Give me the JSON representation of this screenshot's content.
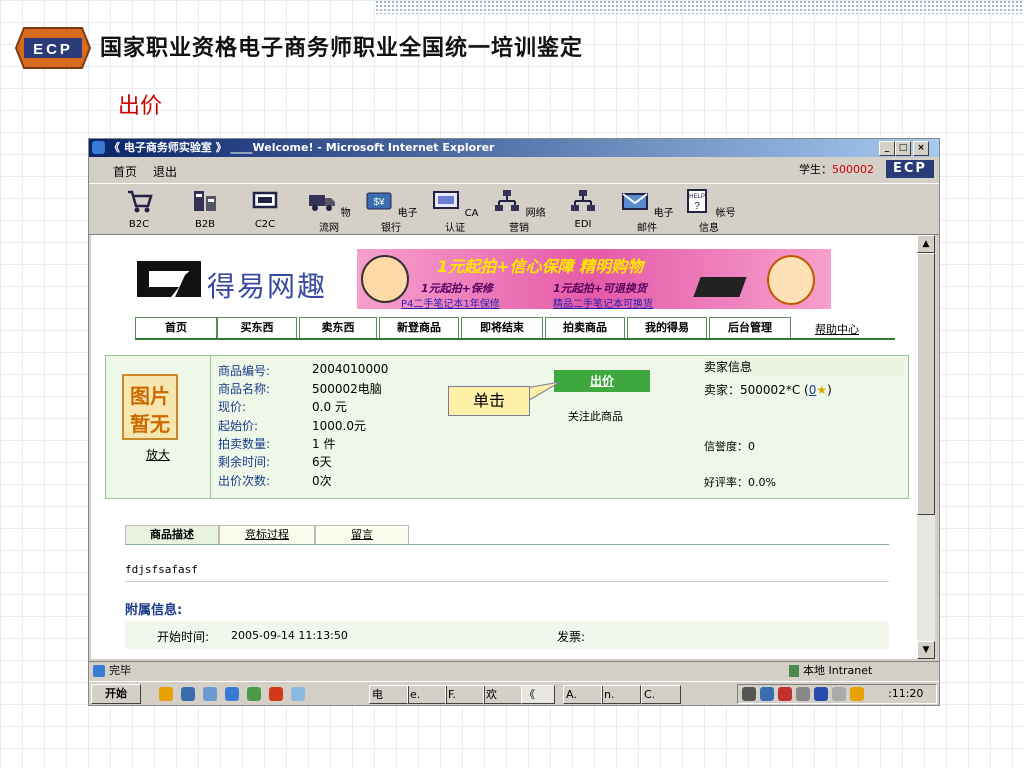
{
  "slide": {
    "title": "国家职业资格电子商务师职业全国统一培训鉴定",
    "subtitle": "出价",
    "logo_text": "ECP"
  },
  "window": {
    "title": "《 电子商务师实验室 》 ____Welcome! - Microsoft Internet Explorer",
    "controls": [
      "_",
      "□",
      "×"
    ]
  },
  "menubar": {
    "items": [
      "首页",
      "退出"
    ],
    "student_label": "学生：",
    "student_id": "500002",
    "brand": "ECP"
  },
  "toolbar": {
    "items": [
      "B2C",
      "B2B",
      "C2C",
      "物流网",
      "电子银行",
      "CA认证",
      "网络营销",
      "EDI",
      "电子邮件",
      "帐号信息"
    ]
  },
  "site": {
    "logo_text": "得易网趣",
    "banner": {
      "line1": "1元起拍+信心保障 精明购物",
      "line2a": "1元起拍+保修",
      "line3a": "P4二手笔记本1年保修",
      "line2b": "1元起拍+可退换货",
      "line3b": "精品二手笔记本可换货"
    },
    "nav": [
      "首页",
      "买东西",
      "卖东西",
      "新登商品",
      "即将结束",
      "拍卖商品",
      "我的得易",
      "后台管理"
    ],
    "help": "帮助中心"
  },
  "product": {
    "image_placeholder": [
      "图片",
      "暂无"
    ],
    "enlarge": "放大",
    "fields": [
      {
        "label": "商品编号:",
        "value": "2004010000"
      },
      {
        "label": "商品名称:",
        "value": "500002电脑"
      },
      {
        "label": "现价:",
        "value": "0.0 元"
      },
      {
        "label": "起始价:",
        "value": "1000.0元"
      },
      {
        "label": "拍卖数量:",
        "value": "1 件"
      },
      {
        "label": "剩余时间:",
        "value": "6天"
      },
      {
        "label": "出价次数:",
        "value": "0次"
      }
    ],
    "bid_button": "出价",
    "follow": "关注此商品",
    "callout": "单击"
  },
  "seller": {
    "heading": "卖家信息",
    "seller_label": "卖家：",
    "seller_value": "500002*C",
    "score": "0",
    "credit": "信誉度：0",
    "rating": "好评率：0.0%"
  },
  "detail_tabs": [
    "商品描述",
    "竞标过程",
    "留言"
  ],
  "description": "fdjsfsafasf",
  "attach": {
    "heading": "附属信息:",
    "start_label": "开始时间:",
    "start_value": "2005-09-14 11:13:50",
    "invoice_label": "发票:"
  },
  "statusbar": {
    "left": "完毕",
    "zone": "本地 Intranet"
  },
  "taskbar": {
    "start": "开始",
    "items": [
      "电",
      "e.",
      "F.",
      "欢",
      "《",
      "A.",
      "n.",
      "C."
    ],
    "clock": ":11:20"
  }
}
